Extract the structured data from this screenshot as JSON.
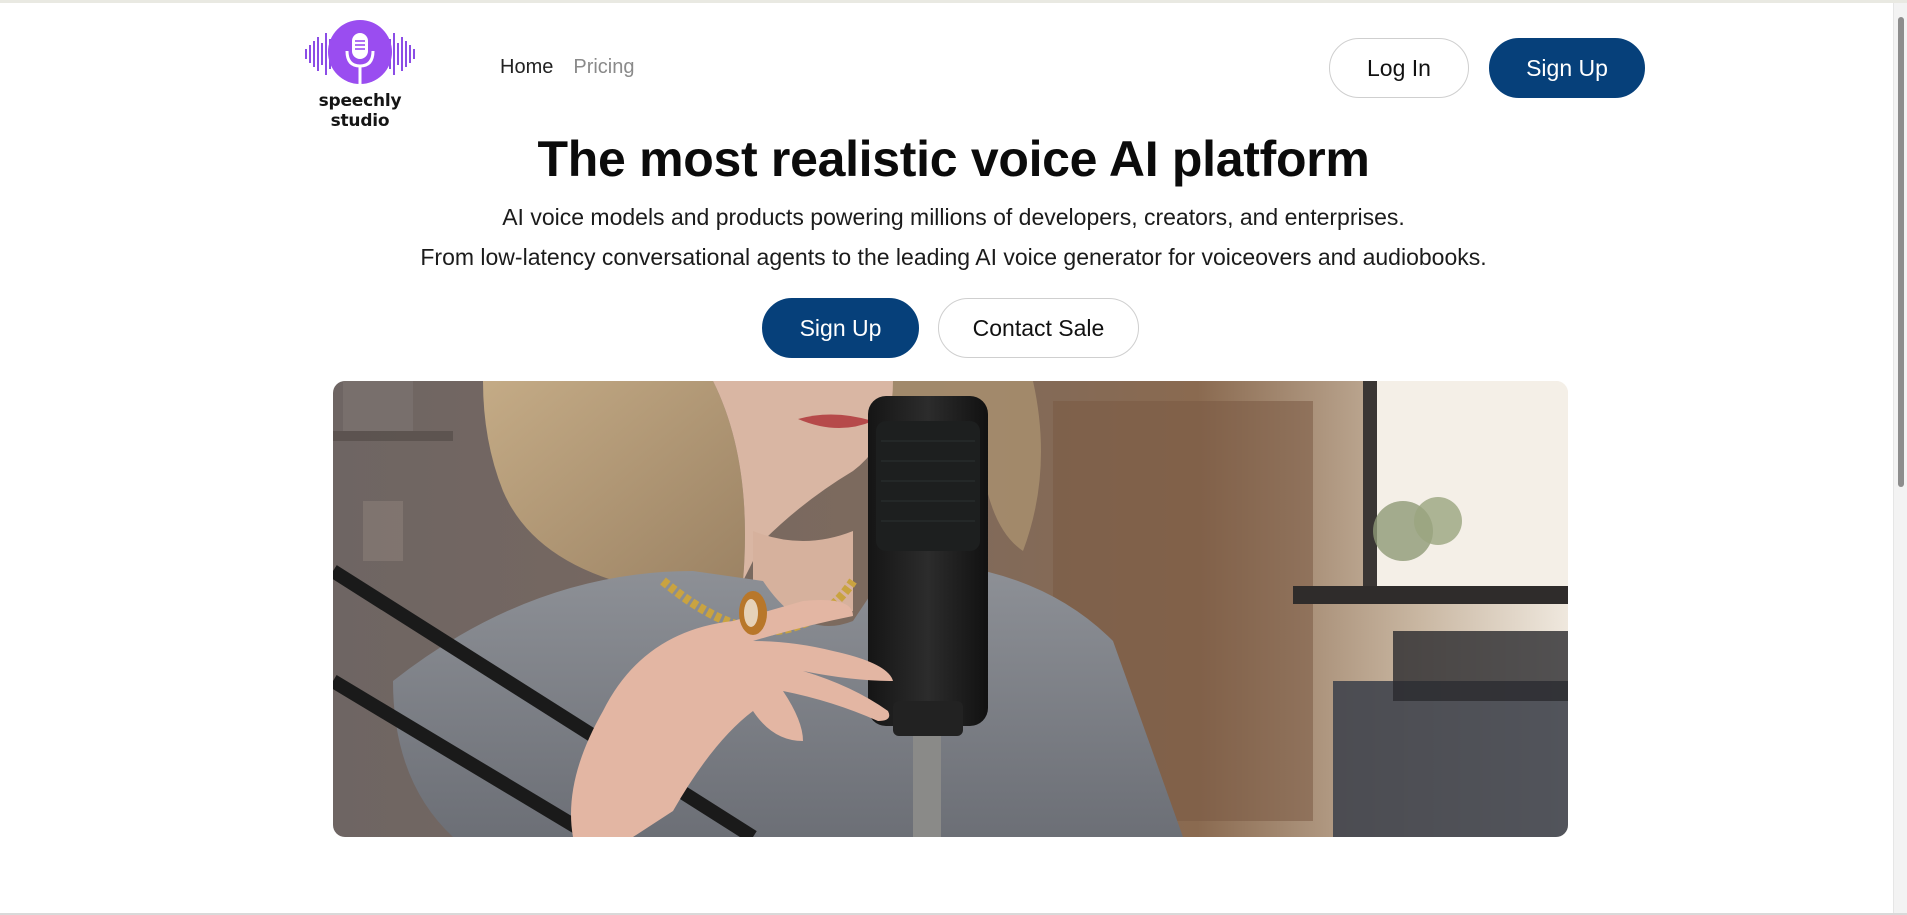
{
  "brand": {
    "name": "speechly studio",
    "accent_color": "#8b4de6",
    "logo_icon": "microphone-soundwave-icon"
  },
  "nav": {
    "items": [
      {
        "label": "Home"
      },
      {
        "label": "Pricing"
      }
    ]
  },
  "header_actions": {
    "login_label": "Log In",
    "signup_label": "Sign Up"
  },
  "hero": {
    "title": "The most realistic voice AI platform",
    "subtitle_line_1": "AI voice models and products powering millions of developers, creators, and enterprises.",
    "subtitle_line_2": "From low-latency conversational agents to the leading AI voice generator for voiceovers and audiobooks.",
    "primary_cta": "Sign Up",
    "secondary_cta": "Contact Sale",
    "primary_color": "#06407a"
  },
  "hero_image": {
    "icon": "podcast-microphone-photo"
  }
}
